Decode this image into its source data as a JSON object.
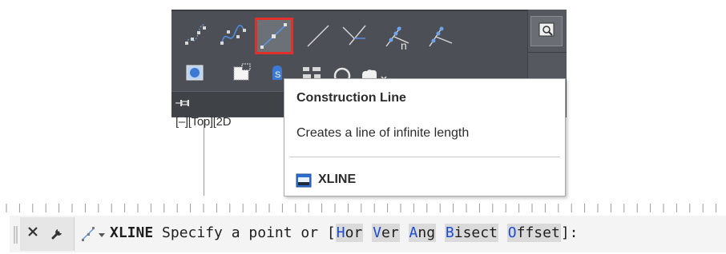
{
  "ribbon": {
    "tools_row1": [
      {
        "name": "multipoint-icon"
      },
      {
        "name": "spline-icon"
      },
      {
        "name": "construction-line-icon",
        "selected": true
      },
      {
        "name": "ray-icon"
      },
      {
        "name": "bisect-line-icon"
      },
      {
        "name": "divide-icon"
      },
      {
        "name": "measure-icon"
      }
    ],
    "tools_row2": [
      {
        "name": "region-icon"
      },
      {
        "name": "boundary-icon"
      },
      {
        "name": "wipeout-icon"
      },
      {
        "name": "revision-cloud-icon"
      },
      {
        "name": "donut-icon"
      },
      {
        "name": "table-icon"
      }
    ],
    "selected_border_color": "#e0302c"
  },
  "viewport": {
    "label": "[–][Top][2D"
  },
  "tooltip": {
    "title": "Construction Line",
    "description": "Creates a line of infinite length",
    "command": "XLINE"
  },
  "command_line": {
    "command": "XLINE",
    "prompt": "Specify a point or [",
    "options": [
      {
        "key": "H",
        "rest": "or"
      },
      {
        "key": "V",
        "rest": "er"
      },
      {
        "key": "A",
        "rest": "ng"
      },
      {
        "key": "B",
        "rest": "isect"
      },
      {
        "key": "O",
        "rest": "ffset"
      }
    ],
    "suffix": "]:",
    "option_key_color": "#1a4bd2"
  }
}
